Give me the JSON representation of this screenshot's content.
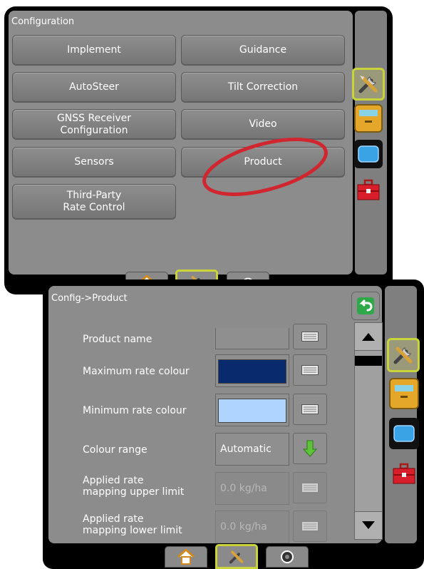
{
  "config_screen": {
    "title": "Configuration",
    "buttons": [
      {
        "label": "Implement"
      },
      {
        "label": "Guidance"
      },
      {
        "label": "AutoSteer"
      },
      {
        "label": "Tilt Correction"
      },
      {
        "label": "GNSS Receiver\nConfiguration"
      },
      {
        "label": "Video"
      },
      {
        "label": "Sensors"
      },
      {
        "label": "Product"
      },
      {
        "label": "Third-Party\nRate Control"
      }
    ],
    "side_icons": [
      "tools-icon",
      "console-icon",
      "screen-icon",
      "toolbox-icon"
    ],
    "tabs": [
      "home-icon",
      "tools-icon",
      "camera-icon"
    ],
    "highlight_color": "#d0262f"
  },
  "product_screen": {
    "title": "Config->Product",
    "rows": [
      {
        "label": "Product name",
        "value": ""
      },
      {
        "label": "Maximum rate colour",
        "color": "#0a2a6e"
      },
      {
        "label": "Minimum rate colour",
        "color": "#aed4ff"
      },
      {
        "label": "Colour range",
        "value": "Automatic"
      },
      {
        "label": "Applied rate\nmapping upper limit",
        "value": "0.0 kg/ha"
      },
      {
        "label": "Applied rate\nmapping lower limit",
        "value": "0.0 kg/ha"
      }
    ],
    "side_icons": [
      "tools-icon",
      "console-icon",
      "screen-icon",
      "toolbox-icon"
    ],
    "tabs": [
      "home-icon",
      "tools-icon",
      "camera-icon"
    ]
  },
  "colors": {
    "selected_border": "#c8d43a",
    "panel_bg": "#8c8c8c"
  }
}
